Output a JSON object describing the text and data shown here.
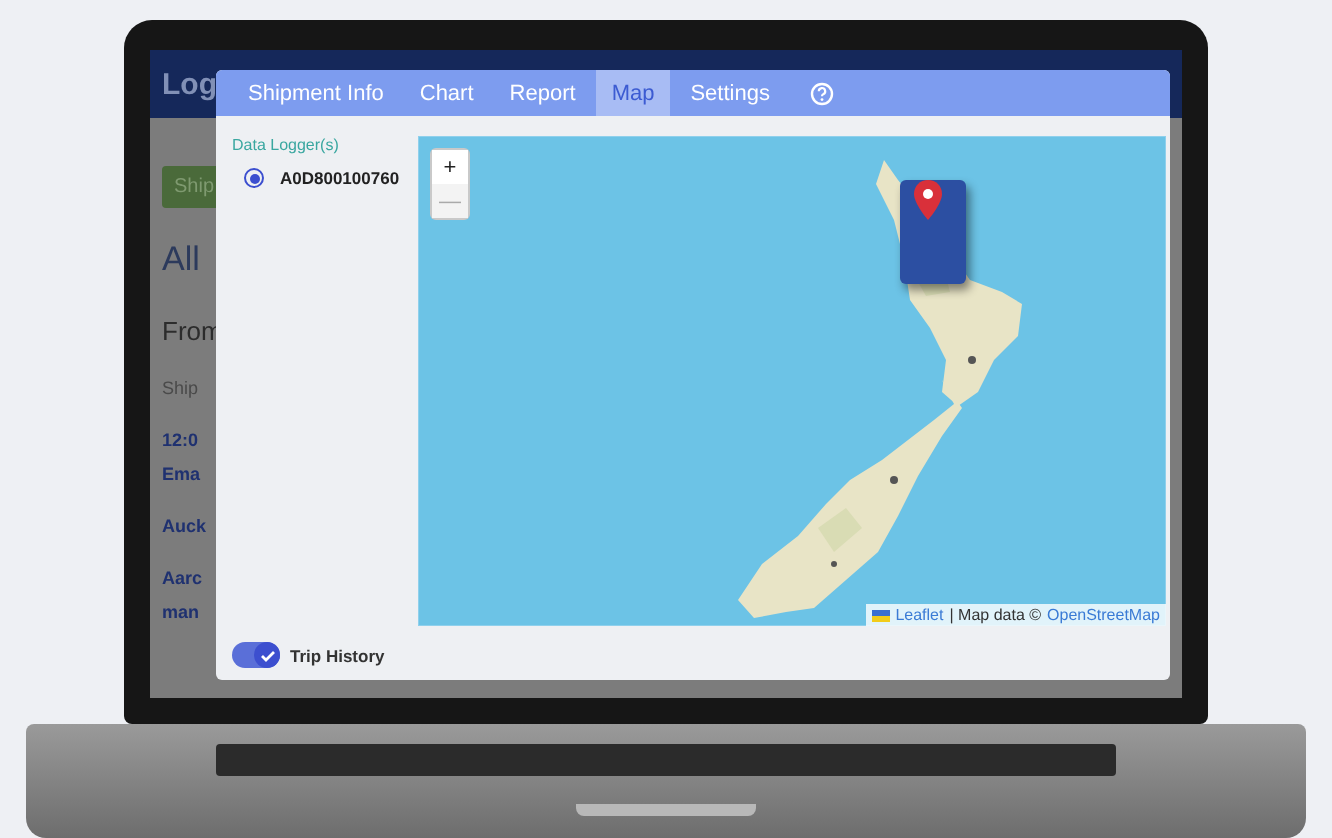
{
  "background_app": {
    "header_title": "Log",
    "button": "Ship",
    "heading": "All",
    "subheading": "From",
    "label": "Ship",
    "entries": [
      "12:0",
      "Ema",
      "Auck",
      "Aarc",
      "man"
    ]
  },
  "dialog": {
    "tabs": [
      {
        "kind": "text",
        "label": "Shipment Info",
        "selected": false
      },
      {
        "kind": "text",
        "label": "Chart",
        "selected": false
      },
      {
        "kind": "text",
        "label": "Report",
        "selected": false
      },
      {
        "kind": "text",
        "label": "Map",
        "selected": true
      },
      {
        "kind": "text",
        "label": "Settings",
        "selected": false
      },
      {
        "kind": "help",
        "selected": false
      }
    ],
    "data_loggers": {
      "label": "Data Logger(s)",
      "items": [
        {
          "id": "A0D800100760",
          "selected": true
        }
      ]
    },
    "map": {
      "kind": "picture",
      "zoom_in": "+",
      "zoom_out": "—",
      "attribution": {
        "link": "Leaflet",
        "text": "| Map data ©",
        "source": "OpenStreetMap"
      }
    },
    "trip_history": {
      "label": "Trip History",
      "on": true
    }
  }
}
